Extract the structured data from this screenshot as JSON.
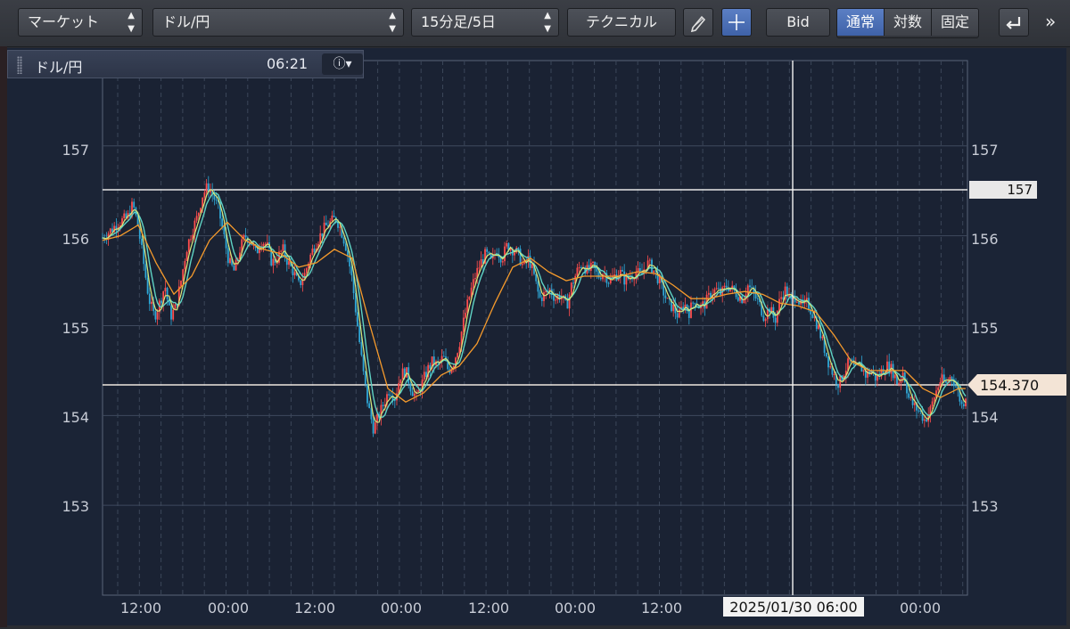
{
  "toolbar": {
    "market_select": "マーケット",
    "symbol_select": "ドル/円",
    "period_select": "15分足/5日",
    "technical_button": "テクニカル",
    "draw_icon": "pencil-icon",
    "crosshair_icon": "plus-icon",
    "bid_button": "Bid",
    "scale_modes": [
      "通常",
      "対数",
      "固定"
    ],
    "active_scale": "通常",
    "undo_icon": "undo-icon",
    "more_icon": "double-chevron-right-icon"
  },
  "info_panel": {
    "symbol": "ドル/円",
    "time": "06:21",
    "info_icon": "info-icon"
  },
  "chart_data": {
    "type": "candlestick",
    "symbol": "ドル/円",
    "y_ticks": [
      "157",
      "156",
      "155",
      "154",
      "153"
    ],
    "ylim": [
      152.0,
      157.95
    ],
    "x_ticks": [
      "12:00",
      "00:00",
      "12:00",
      "00:00",
      "12:00",
      "00:00",
      "12:00",
      "2025/01/30 06:00",
      "00:00"
    ],
    "crosshair_label": "2025/01/30 06:00",
    "horizontal_line_labels": [
      "157",
      "154.370"
    ],
    "horizontal_line_values": [
      156.55,
      154.37
    ],
    "current_price": "154.370",
    "colors": {
      "background": "#1b2436",
      "up": "#ff4d4d",
      "down": "#2fa7d6",
      "ma_short": "#d8e87a",
      "ma_short2": "#5fd3c4",
      "ma_long": "#f59a2c",
      "grid": "#4a566c",
      "crosshair": "#ffffff"
    },
    "price_path": [
      [
        0,
        155.98
      ],
      [
        8,
        156.05
      ],
      [
        18,
        156.15
      ],
      [
        28,
        156.2
      ],
      [
        34,
        156.35
      ],
      [
        40,
        156.1
      ],
      [
        46,
        155.7
      ],
      [
        52,
        155.3
      ],
      [
        58,
        155.1
      ],
      [
        64,
        155.25
      ],
      [
        70,
        155.45
      ],
      [
        76,
        155.1
      ],
      [
        82,
        155.2
      ],
      [
        88,
        155.5
      ],
      [
        94,
        155.85
      ],
      [
        100,
        156.05
      ],
      [
        106,
        156.2
      ],
      [
        112,
        156.45
      ],
      [
        118,
        156.55
      ],
      [
        124,
        156.45
      ],
      [
        130,
        156.3
      ],
      [
        136,
        156.0
      ],
      [
        142,
        155.7
      ],
      [
        148,
        155.6
      ],
      [
        154,
        155.85
      ],
      [
        160,
        156.0
      ],
      [
        166,
        155.95
      ],
      [
        172,
        155.8
      ],
      [
        178,
        155.95
      ],
      [
        184,
        155.9
      ],
      [
        190,
        155.7
      ],
      [
        196,
        155.75
      ],
      [
        202,
        155.85
      ],
      [
        208,
        155.7
      ],
      [
        214,
        155.6
      ],
      [
        220,
        155.45
      ],
      [
        226,
        155.55
      ],
      [
        232,
        155.75
      ],
      [
        238,
        155.9
      ],
      [
        244,
        156.0
      ],
      [
        250,
        156.1
      ],
      [
        256,
        156.15
      ],
      [
        262,
        156.2
      ],
      [
        268,
        156.05
      ],
      [
        274,
        155.85
      ],
      [
        280,
        155.5
      ],
      [
        286,
        155.0
      ],
      [
        292,
        154.5
      ],
      [
        298,
        154.1
      ],
      [
        304,
        153.85
      ],
      [
        310,
        154.0
      ],
      [
        316,
        154.15
      ],
      [
        322,
        154.3
      ],
      [
        328,
        154.2
      ],
      [
        334,
        154.45
      ],
      [
        340,
        154.5
      ],
      [
        346,
        154.3
      ],
      [
        352,
        154.2
      ],
      [
        358,
        154.35
      ],
      [
        364,
        154.5
      ],
      [
        370,
        154.6
      ],
      [
        376,
        154.55
      ],
      [
        382,
        154.65
      ],
      [
        388,
        154.5
      ],
      [
        394,
        154.6
      ],
      [
        400,
        154.8
      ],
      [
        406,
        155.1
      ],
      [
        412,
        155.35
      ],
      [
        418,
        155.55
      ],
      [
        424,
        155.7
      ],
      [
        430,
        155.8
      ],
      [
        436,
        155.7
      ],
      [
        442,
        155.85
      ],
      [
        448,
        155.75
      ],
      [
        454,
        155.9
      ],
      [
        460,
        155.85
      ],
      [
        466,
        155.8
      ],
      [
        472,
        155.65
      ],
      [
        478,
        155.75
      ],
      [
        484,
        155.55
      ],
      [
        490,
        155.3
      ],
      [
        496,
        155.35
      ],
      [
        502,
        155.4
      ],
      [
        508,
        155.3
      ],
      [
        514,
        155.35
      ],
      [
        520,
        155.2
      ],
      [
        526,
        155.45
      ],
      [
        532,
        155.6
      ],
      [
        538,
        155.7
      ],
      [
        544,
        155.6
      ],
      [
        550,
        155.65
      ],
      [
        556,
        155.55
      ],
      [
        562,
        155.6
      ],
      [
        568,
        155.5
      ],
      [
        574,
        155.55
      ],
      [
        580,
        155.6
      ],
      [
        586,
        155.5
      ],
      [
        592,
        155.55
      ],
      [
        598,
        155.6
      ],
      [
        604,
        155.55
      ],
      [
        610,
        155.7
      ],
      [
        616,
        155.65
      ],
      [
        622,
        155.55
      ],
      [
        628,
        155.4
      ],
      [
        634,
        155.25
      ],
      [
        640,
        155.2
      ],
      [
        646,
        155.1
      ],
      [
        652,
        155.25
      ],
      [
        658,
        155.15
      ],
      [
        664,
        155.3
      ],
      [
        670,
        155.2
      ],
      [
        676,
        155.25
      ],
      [
        682,
        155.35
      ],
      [
        688,
        155.4
      ],
      [
        694,
        155.35
      ],
      [
        700,
        155.45
      ],
      [
        706,
        155.4
      ],
      [
        712,
        155.35
      ],
      [
        718,
        155.3
      ],
      [
        724,
        155.45
      ],
      [
        730,
        155.35
      ],
      [
        736,
        155.25
      ],
      [
        742,
        155.1
      ],
      [
        748,
        155.2
      ],
      [
        754,
        155.05
      ],
      [
        760,
        155.3
      ],
      [
        766,
        155.4
      ],
      [
        772,
        155.25
      ],
      [
        778,
        155.35
      ],
      [
        784,
        155.2
      ],
      [
        790,
        155.25
      ],
      [
        796,
        155.15
      ],
      [
        802,
        155.0
      ],
      [
        808,
        154.8
      ],
      [
        814,
        154.6
      ],
      [
        820,
        154.45
      ],
      [
        826,
        154.35
      ],
      [
        832,
        154.5
      ],
      [
        838,
        154.6
      ],
      [
        844,
        154.5
      ],
      [
        850,
        154.55
      ],
      [
        856,
        154.45
      ],
      [
        862,
        154.5
      ],
      [
        868,
        154.4
      ],
      [
        874,
        154.5
      ],
      [
        880,
        154.55
      ],
      [
        886,
        154.5
      ],
      [
        892,
        154.35
      ],
      [
        898,
        154.5
      ],
      [
        904,
        154.2
      ],
      [
        910,
        154.1
      ],
      [
        916,
        154.05
      ],
      [
        922,
        153.95
      ],
      [
        928,
        154.05
      ],
      [
        934,
        154.25
      ],
      [
        940,
        154.4
      ],
      [
        946,
        154.35
      ],
      [
        952,
        154.45
      ],
      [
        958,
        154.3
      ],
      [
        964,
        154.1
      ],
      [
        970,
        154.3
      ]
    ],
    "ma_long_path": [
      [
        0,
        155.95
      ],
      [
        20,
        156.0
      ],
      [
        40,
        156.12
      ],
      [
        60,
        155.7
      ],
      [
        80,
        155.35
      ],
      [
        100,
        155.55
      ],
      [
        120,
        155.95
      ],
      [
        140,
        156.15
      ],
      [
        160,
        155.95
      ],
      [
        180,
        155.85
      ],
      [
        200,
        155.8
      ],
      [
        220,
        155.65
      ],
      [
        240,
        155.7
      ],
      [
        260,
        155.85
      ],
      [
        280,
        155.75
      ],
      [
        300,
        155.0
      ],
      [
        320,
        154.3
      ],
      [
        340,
        154.15
      ],
      [
        360,
        154.25
      ],
      [
        380,
        154.45
      ],
      [
        400,
        154.55
      ],
      [
        420,
        154.8
      ],
      [
        440,
        155.25
      ],
      [
        460,
        155.65
      ],
      [
        480,
        155.75
      ],
      [
        500,
        155.6
      ],
      [
        520,
        155.5
      ],
      [
        540,
        155.55
      ],
      [
        560,
        155.55
      ],
      [
        580,
        155.55
      ],
      [
        600,
        155.6
      ],
      [
        620,
        155.58
      ],
      [
        640,
        155.45
      ],
      [
        660,
        155.3
      ],
      [
        680,
        155.3
      ],
      [
        700,
        155.35
      ],
      [
        720,
        155.38
      ],
      [
        740,
        155.35
      ],
      [
        760,
        155.25
      ],
      [
        780,
        155.22
      ],
      [
        800,
        155.15
      ],
      [
        820,
        154.9
      ],
      [
        840,
        154.6
      ],
      [
        860,
        154.5
      ],
      [
        880,
        154.5
      ],
      [
        900,
        154.5
      ],
      [
        920,
        154.3
      ],
      [
        940,
        154.2
      ],
      [
        960,
        154.3
      ],
      [
        970,
        154.3
      ]
    ]
  }
}
